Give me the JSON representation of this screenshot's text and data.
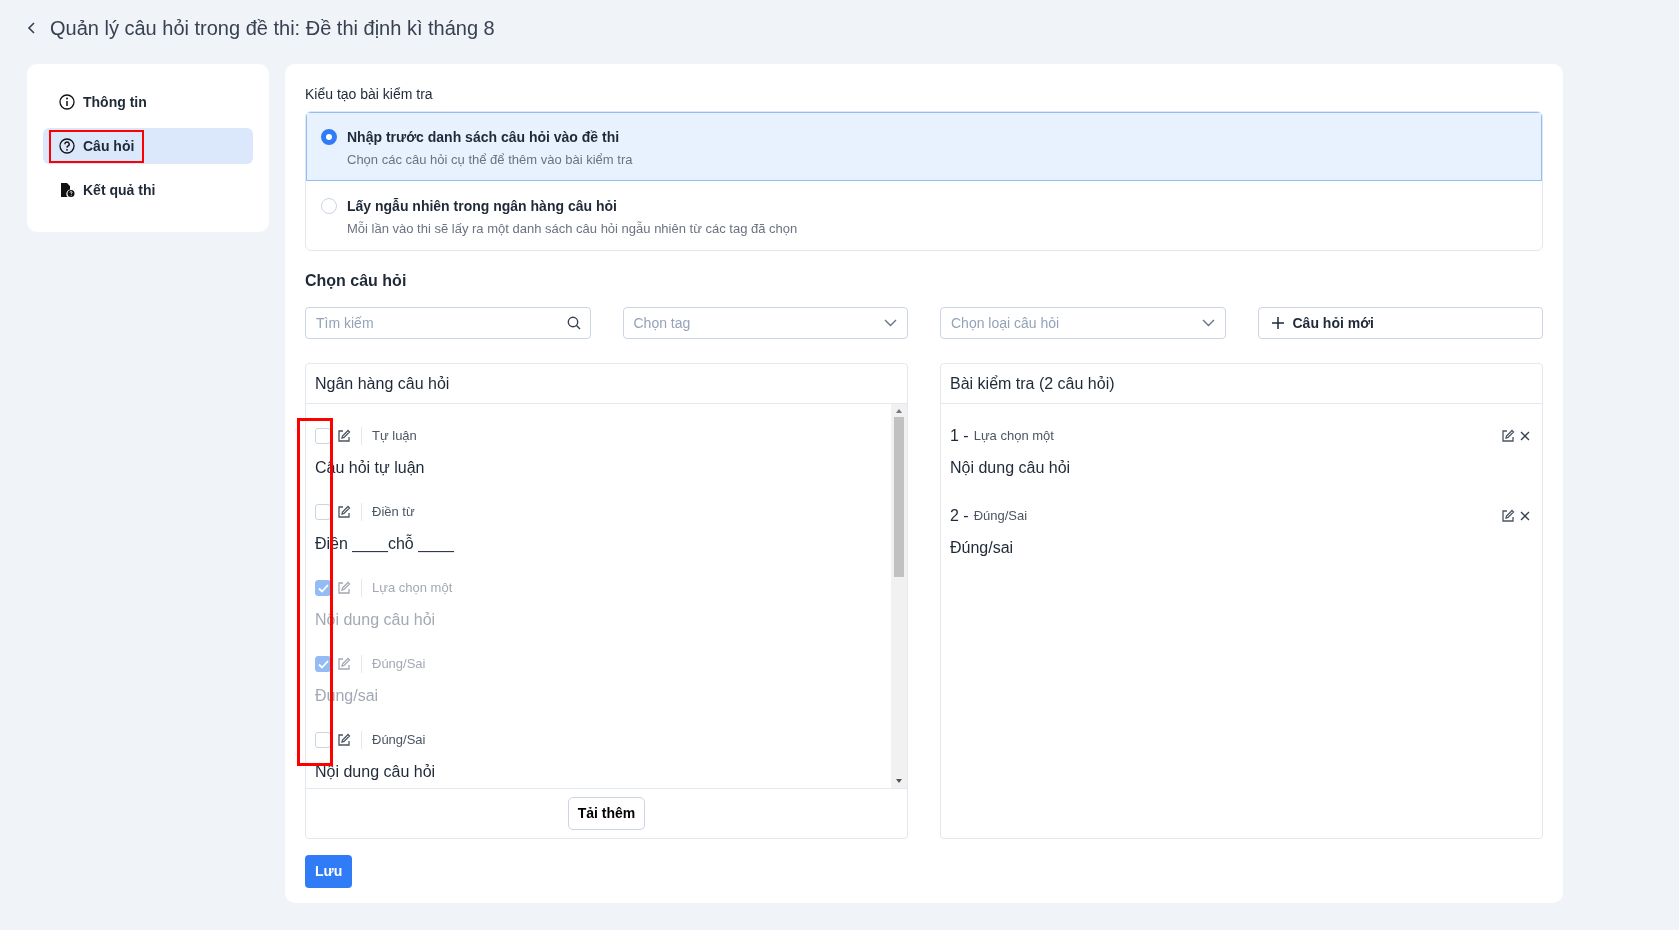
{
  "header": {
    "title": "Quản lý câu hỏi trong đề thi: Đề thi định kì tháng 8"
  },
  "sidebar": {
    "items": [
      {
        "kind": "info",
        "label": "Thông tin",
        "selected": false,
        "annotated": false
      },
      {
        "kind": "question",
        "label": "Câu hỏi",
        "selected": true,
        "annotated": true
      },
      {
        "kind": "result",
        "label": "Kết quả thi",
        "selected": false,
        "annotated": false
      }
    ]
  },
  "creation_mode": {
    "label": "Kiểu tạo bài kiểm tra",
    "options": [
      {
        "title": "Nhập trước danh sách câu hỏi vào đề thi",
        "description": "Chọn các câu hỏi cụ thể để thêm vào bài kiểm tra",
        "selected": true
      },
      {
        "title": "Lấy ngẫu nhiên trong ngân hàng câu hỏi",
        "description": "Mỗi lần vào thi sẽ lấy ra một danh sách câu hỏi ngẫu nhiên từ các tag đã chọn",
        "selected": false
      }
    ]
  },
  "select_questions": {
    "heading": "Chọn câu hỏi",
    "search": {
      "placeholder": "Tìm kiếm"
    },
    "tag_select": {
      "placeholder": "Chọn tag"
    },
    "type_select": {
      "placeholder": "Chọn loại câu hỏi"
    },
    "new_button": "Câu hỏi mới"
  },
  "bank": {
    "title": "Ngân hàng câu hỏi",
    "checkbox_column_annotated": true,
    "items": [
      {
        "type": "Tự luận",
        "content": "Câu hỏi tự luận",
        "checked": false
      },
      {
        "type": "Điền từ",
        "content": "Điền ____chỗ ____",
        "checked": false
      },
      {
        "type": "Lựa chọn một",
        "content": "Nội dung câu hỏi",
        "checked": true
      },
      {
        "type": "Đúng/Sai",
        "content": "Đúng/sai",
        "checked": true
      },
      {
        "type": "Đúng/Sai",
        "content": "Nội dung câu hỏi",
        "checked": false
      }
    ],
    "load_more": "Tải thêm"
  },
  "test": {
    "title": "Bài kiểm tra (2 câu hỏi)",
    "items": [
      {
        "number": "1 -",
        "type": "Lựa chọn một",
        "content": "Nội dung câu hỏi"
      },
      {
        "number": "2 -",
        "type": "Đúng/Sai",
        "content": "Đúng/sai"
      }
    ]
  },
  "save_button": "Lưu"
}
